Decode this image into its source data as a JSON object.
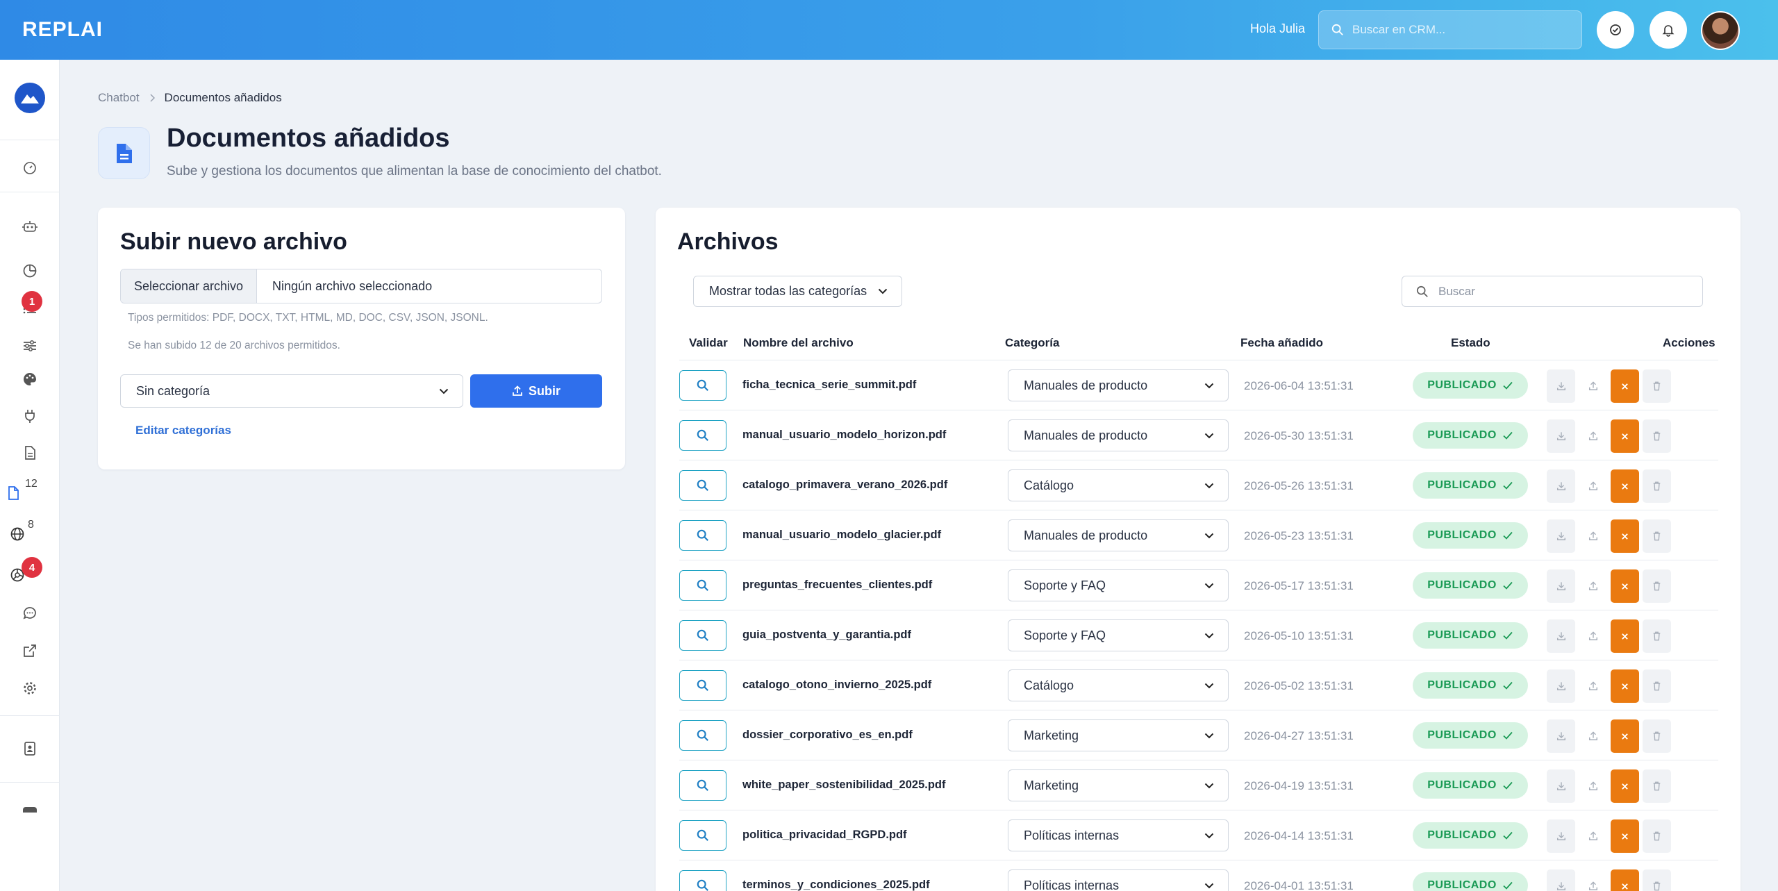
{
  "header": {
    "logo": "REPLAI",
    "greeting": "Hola Julia",
    "search_placeholder": "Buscar en CRM..."
  },
  "sidebar": {
    "badges": {
      "lists": "1",
      "documents": "12",
      "web": "8",
      "integrations": "4"
    }
  },
  "breadcrumb": {
    "parent": "Chatbot",
    "current": "Documentos añadidos"
  },
  "page": {
    "title": "Documentos añadidos",
    "subtitle": "Sube y gestiona los documentos que alimentan la base de conocimiento del chatbot."
  },
  "upload": {
    "title": "Subir nuevo archivo",
    "file_button": "Seleccionar archivo",
    "file_none": "Ningún archivo seleccionado",
    "allowed_types": "Tipos permitidos: PDF, DOCX, TXT, HTML, MD, DOC, CSV, JSON, JSONL.",
    "uploaded_count": "Se han subido 12 de 20 archivos permitidos.",
    "category_selected": "Sin categoría",
    "upload_button": "Subir",
    "edit_categories": "Editar categorías"
  },
  "files": {
    "title": "Archivos",
    "filter_selected": "Mostrar todas las categorías",
    "search_placeholder": "Buscar",
    "columns": {
      "validate": "Validar",
      "name": "Nombre del archivo",
      "category": "Categoría",
      "date": "Fecha añadido",
      "status": "Estado",
      "actions": "Acciones"
    },
    "rows": [
      {
        "name": "ficha_tecnica_serie_summit.pdf",
        "category": "Manuales de producto",
        "date": "2026-06-04 13:51:31",
        "status": "PUBLICADO"
      },
      {
        "name": "manual_usuario_modelo_horizon.pdf",
        "category": "Manuales de producto",
        "date": "2026-05-30 13:51:31",
        "status": "PUBLICADO"
      },
      {
        "name": "catalogo_primavera_verano_2026.pdf",
        "category": "Catálogo",
        "date": "2026-05-26 13:51:31",
        "status": "PUBLICADO"
      },
      {
        "name": "manual_usuario_modelo_glacier.pdf",
        "category": "Manuales de producto",
        "date": "2026-05-23 13:51:31",
        "status": "PUBLICADO"
      },
      {
        "name": "preguntas_frecuentes_clientes.pdf",
        "category": "Soporte y FAQ",
        "date": "2026-05-17 13:51:31",
        "status": "PUBLICADO"
      },
      {
        "name": "guia_postventa_y_garantia.pdf",
        "category": "Soporte y FAQ",
        "date": "2026-05-10 13:51:31",
        "status": "PUBLICADO"
      },
      {
        "name": "catalogo_otono_invierno_2025.pdf",
        "category": "Catálogo",
        "date": "2026-05-02 13:51:31",
        "status": "PUBLICADO"
      },
      {
        "name": "dossier_corporativo_es_en.pdf",
        "category": "Marketing",
        "date": "2026-04-27 13:51:31",
        "status": "PUBLICADO"
      },
      {
        "name": "white_paper_sostenibilidad_2025.pdf",
        "category": "Marketing",
        "date": "2026-04-19 13:51:31",
        "status": "PUBLICADO"
      },
      {
        "name": "politica_privacidad_RGPD.pdf",
        "category": "Políticas internas",
        "date": "2026-04-14 13:51:31",
        "status": "PUBLICADO"
      },
      {
        "name": "terminos_y_condiciones_2025.pdf",
        "category": "Políticas internas",
        "date": "2026-04-01 13:51:31",
        "status": "PUBLICADO"
      }
    ]
  },
  "colors": {
    "primary": "#2f6fec",
    "status_bg": "#d6f3e2",
    "status_text": "#1a9a55",
    "remove_action": "#ea7a10",
    "badge": "#e03240"
  }
}
